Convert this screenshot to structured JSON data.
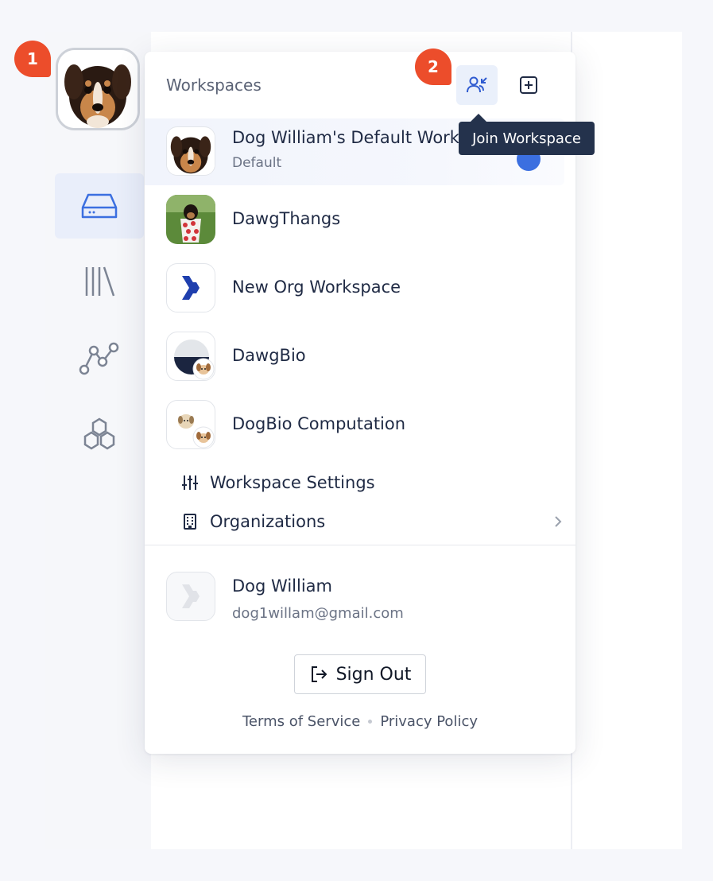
{
  "badges": {
    "first": "1",
    "second": "2"
  },
  "menu": {
    "title": "Workspaces",
    "tooltip": "Join Workspace",
    "workspaces": [
      {
        "name": "Dog William's Default Workspace",
        "subtitle": "Default",
        "avatar": "dog-photo-avatar",
        "selected": true
      },
      {
        "name": "DawgThangs",
        "avatar": "dog-in-cup-photo-avatar"
      },
      {
        "name": "New Org Workspace",
        "avatar": "blue-chevron-logo-avatar"
      },
      {
        "name": "DawgBio",
        "avatar": "half-circle-logo-avatar"
      },
      {
        "name": "DogBio Computation",
        "avatar": "dog-illustration-avatar"
      }
    ],
    "actions": {
      "settings": "Workspace Settings",
      "organizations": "Organizations"
    },
    "user": {
      "name": "Dog William",
      "email": "dog1willam@gmail.com"
    },
    "signout_label": "Sign Out",
    "footer": {
      "terms": "Terms of Service",
      "privacy": "Privacy Policy"
    }
  },
  "colors": {
    "badge": "#ec4d2b",
    "tooltip_bg": "#24324c",
    "accent": "#3b6fe0",
    "text": "#1f2a44"
  }
}
